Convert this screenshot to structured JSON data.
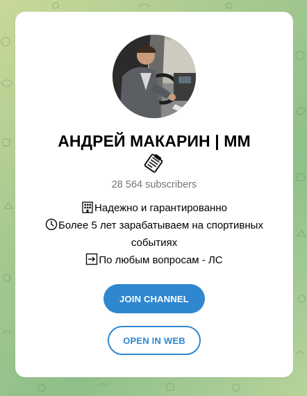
{
  "channel": {
    "title": "АНДРЕЙ МАКАРИН | ММ",
    "subscribers": "28 564 subscribers",
    "description": [
      {
        "icon": "office-building-icon",
        "text": "Надежно и гарантированно"
      },
      {
        "icon": "clock-icon",
        "text": "Более 5 лет зарабатываем на спортивных"
      },
      {
        "icon": "",
        "text": "событиях"
      },
      {
        "icon": "arrow-right-icon",
        "text": "По любым вопросам - ЛС"
      }
    ]
  },
  "buttons": {
    "join_label": "JOIN CHANNEL",
    "open_web_label": "OPEN IN WEB"
  },
  "colors": {
    "accent": "#2f87d0",
    "muted_text": "#707579",
    "card_bg": "#ffffff"
  }
}
